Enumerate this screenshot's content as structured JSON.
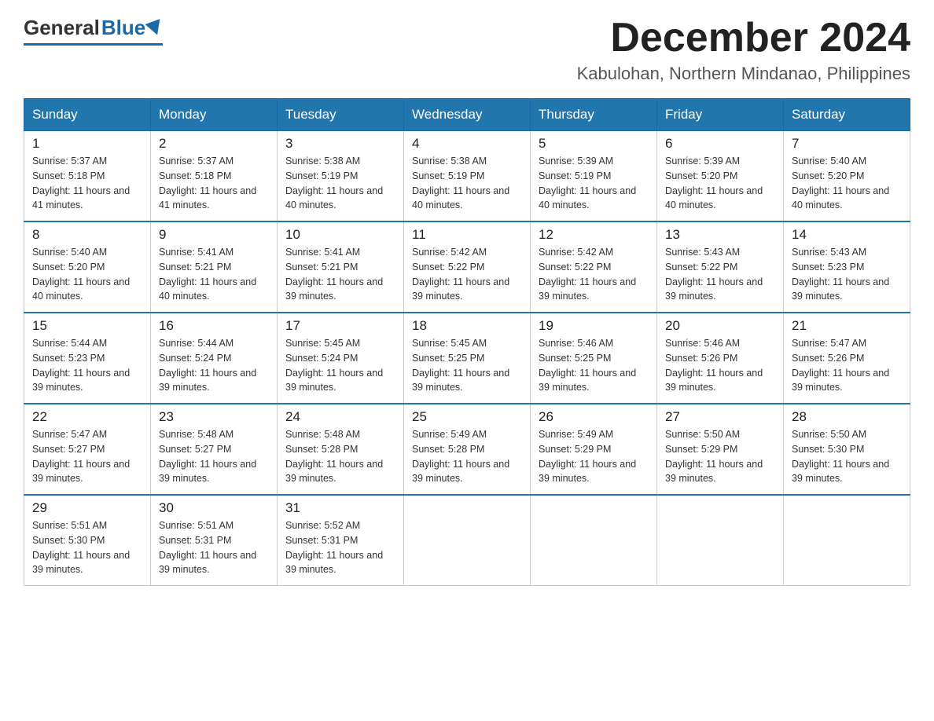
{
  "logo": {
    "general": "General",
    "blue": "Blue"
  },
  "title": "December 2024",
  "location": "Kabulohan, Northern Mindanao, Philippines",
  "days_of_week": [
    "Sunday",
    "Monday",
    "Tuesday",
    "Wednesday",
    "Thursday",
    "Friday",
    "Saturday"
  ],
  "weeks": [
    [
      {
        "day": "1",
        "sunrise": "5:37 AM",
        "sunset": "5:18 PM",
        "daylight": "11 hours and 41 minutes."
      },
      {
        "day": "2",
        "sunrise": "5:37 AM",
        "sunset": "5:18 PM",
        "daylight": "11 hours and 41 minutes."
      },
      {
        "day": "3",
        "sunrise": "5:38 AM",
        "sunset": "5:19 PM",
        "daylight": "11 hours and 40 minutes."
      },
      {
        "day": "4",
        "sunrise": "5:38 AM",
        "sunset": "5:19 PM",
        "daylight": "11 hours and 40 minutes."
      },
      {
        "day": "5",
        "sunrise": "5:39 AM",
        "sunset": "5:19 PM",
        "daylight": "11 hours and 40 minutes."
      },
      {
        "day": "6",
        "sunrise": "5:39 AM",
        "sunset": "5:20 PM",
        "daylight": "11 hours and 40 minutes."
      },
      {
        "day": "7",
        "sunrise": "5:40 AM",
        "sunset": "5:20 PM",
        "daylight": "11 hours and 40 minutes."
      }
    ],
    [
      {
        "day": "8",
        "sunrise": "5:40 AM",
        "sunset": "5:20 PM",
        "daylight": "11 hours and 40 minutes."
      },
      {
        "day": "9",
        "sunrise": "5:41 AM",
        "sunset": "5:21 PM",
        "daylight": "11 hours and 40 minutes."
      },
      {
        "day": "10",
        "sunrise": "5:41 AM",
        "sunset": "5:21 PM",
        "daylight": "11 hours and 39 minutes."
      },
      {
        "day": "11",
        "sunrise": "5:42 AM",
        "sunset": "5:22 PM",
        "daylight": "11 hours and 39 minutes."
      },
      {
        "day": "12",
        "sunrise": "5:42 AM",
        "sunset": "5:22 PM",
        "daylight": "11 hours and 39 minutes."
      },
      {
        "day": "13",
        "sunrise": "5:43 AM",
        "sunset": "5:22 PM",
        "daylight": "11 hours and 39 minutes."
      },
      {
        "day": "14",
        "sunrise": "5:43 AM",
        "sunset": "5:23 PM",
        "daylight": "11 hours and 39 minutes."
      }
    ],
    [
      {
        "day": "15",
        "sunrise": "5:44 AM",
        "sunset": "5:23 PM",
        "daylight": "11 hours and 39 minutes."
      },
      {
        "day": "16",
        "sunrise": "5:44 AM",
        "sunset": "5:24 PM",
        "daylight": "11 hours and 39 minutes."
      },
      {
        "day": "17",
        "sunrise": "5:45 AM",
        "sunset": "5:24 PM",
        "daylight": "11 hours and 39 minutes."
      },
      {
        "day": "18",
        "sunrise": "5:45 AM",
        "sunset": "5:25 PM",
        "daylight": "11 hours and 39 minutes."
      },
      {
        "day": "19",
        "sunrise": "5:46 AM",
        "sunset": "5:25 PM",
        "daylight": "11 hours and 39 minutes."
      },
      {
        "day": "20",
        "sunrise": "5:46 AM",
        "sunset": "5:26 PM",
        "daylight": "11 hours and 39 minutes."
      },
      {
        "day": "21",
        "sunrise": "5:47 AM",
        "sunset": "5:26 PM",
        "daylight": "11 hours and 39 minutes."
      }
    ],
    [
      {
        "day": "22",
        "sunrise": "5:47 AM",
        "sunset": "5:27 PM",
        "daylight": "11 hours and 39 minutes."
      },
      {
        "day": "23",
        "sunrise": "5:48 AM",
        "sunset": "5:27 PM",
        "daylight": "11 hours and 39 minutes."
      },
      {
        "day": "24",
        "sunrise": "5:48 AM",
        "sunset": "5:28 PM",
        "daylight": "11 hours and 39 minutes."
      },
      {
        "day": "25",
        "sunrise": "5:49 AM",
        "sunset": "5:28 PM",
        "daylight": "11 hours and 39 minutes."
      },
      {
        "day": "26",
        "sunrise": "5:49 AM",
        "sunset": "5:29 PM",
        "daylight": "11 hours and 39 minutes."
      },
      {
        "day": "27",
        "sunrise": "5:50 AM",
        "sunset": "5:29 PM",
        "daylight": "11 hours and 39 minutes."
      },
      {
        "day": "28",
        "sunrise": "5:50 AM",
        "sunset": "5:30 PM",
        "daylight": "11 hours and 39 minutes."
      }
    ],
    [
      {
        "day": "29",
        "sunrise": "5:51 AM",
        "sunset": "5:30 PM",
        "daylight": "11 hours and 39 minutes."
      },
      {
        "day": "30",
        "sunrise": "5:51 AM",
        "sunset": "5:31 PM",
        "daylight": "11 hours and 39 minutes."
      },
      {
        "day": "31",
        "sunrise": "5:52 AM",
        "sunset": "5:31 PM",
        "daylight": "11 hours and 39 minutes."
      },
      null,
      null,
      null,
      null
    ]
  ]
}
